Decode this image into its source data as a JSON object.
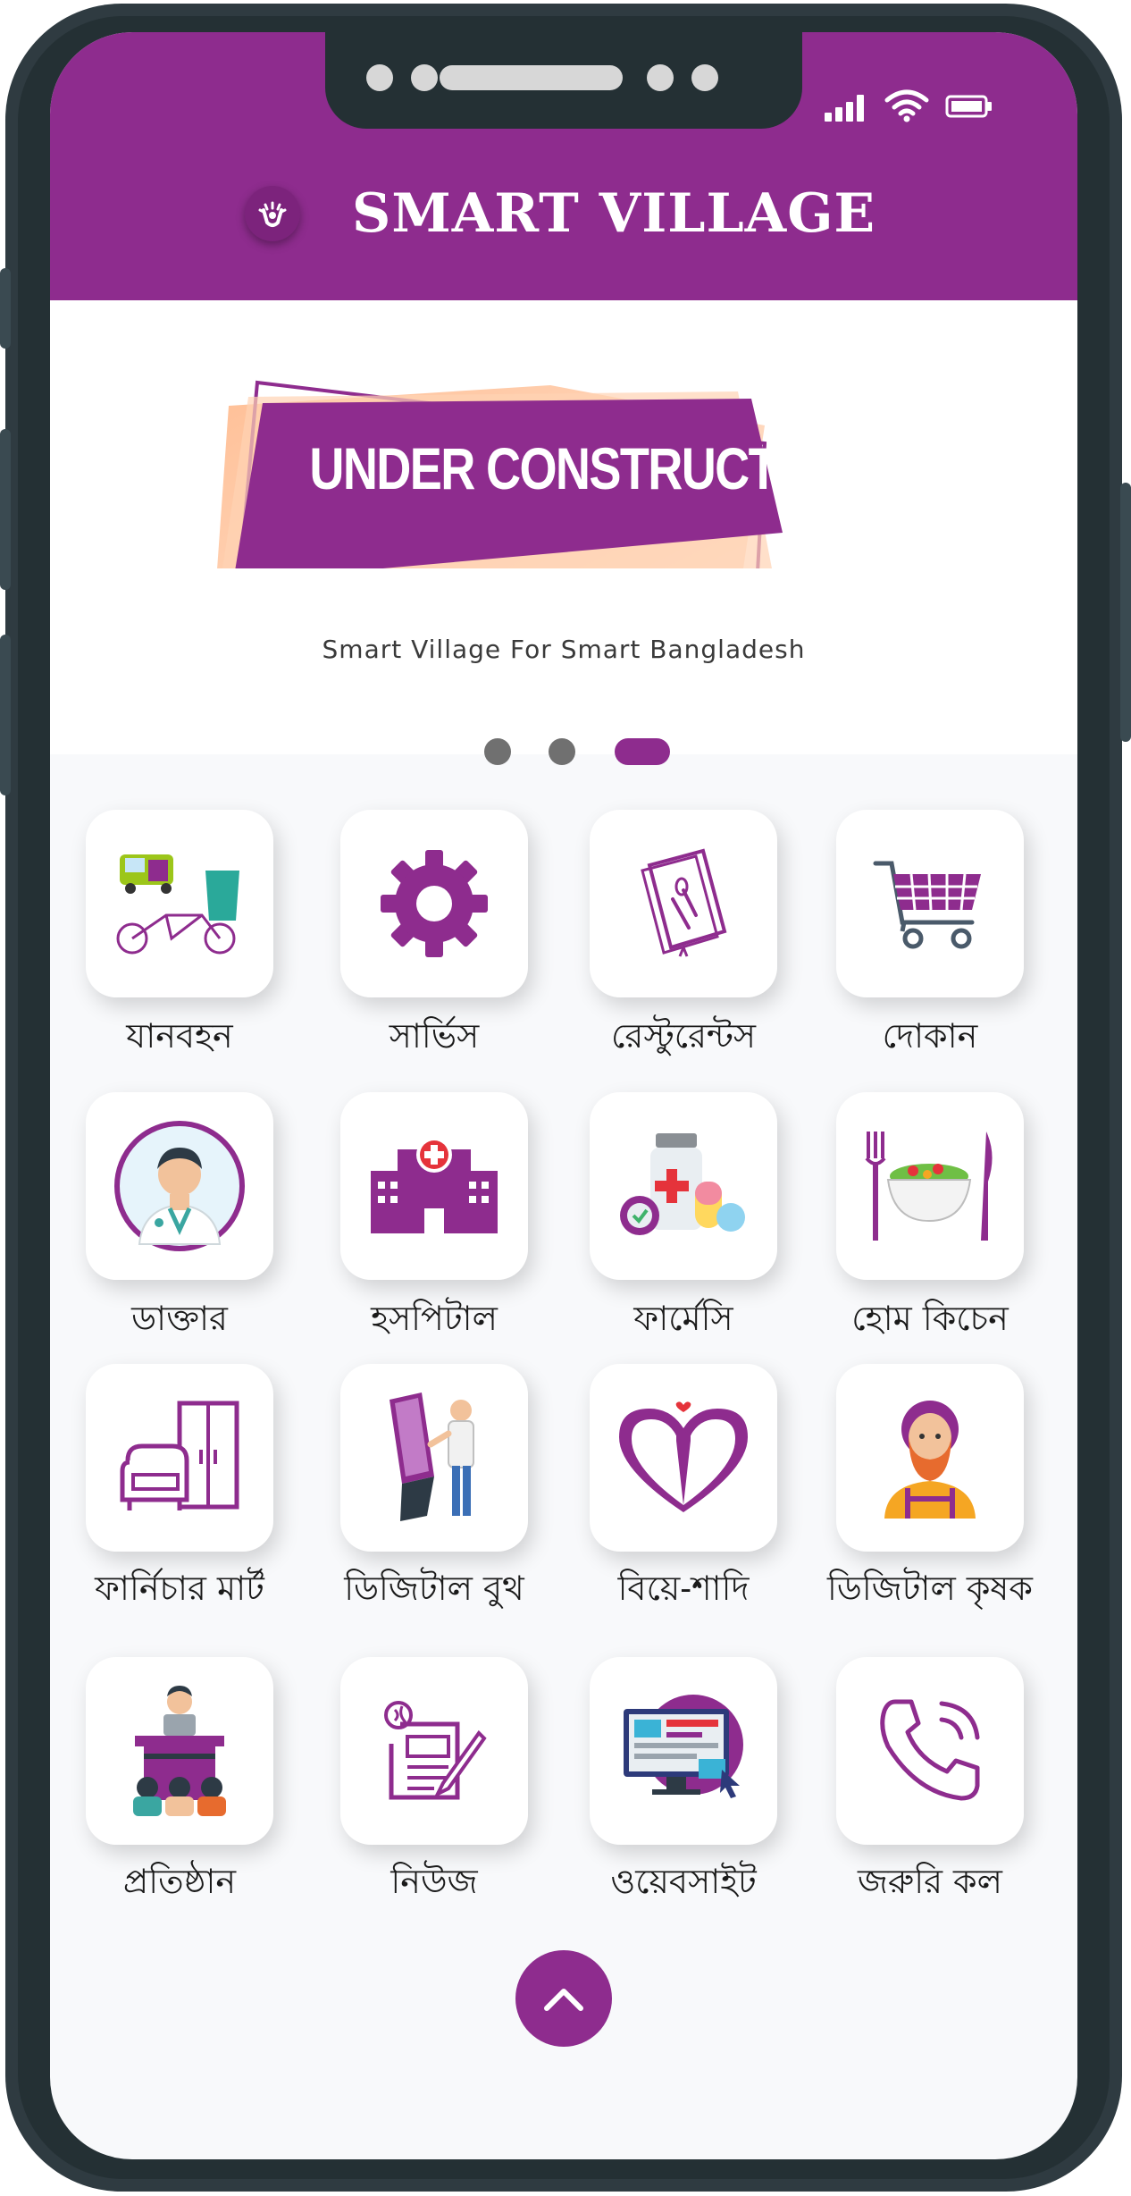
{
  "app": {
    "title": "SMART VILLAGE",
    "banner_text": "UNDER CONSTRUCTION",
    "tagline": "Smart Village For Smart Bangladesh",
    "accent_color": "#8e2c8e"
  },
  "status_bar": {
    "icons": [
      "signal-icon",
      "wifi-icon",
      "battery-icon"
    ]
  },
  "carousel": {
    "slides": 3,
    "active_index": 2
  },
  "services": [
    {
      "label": "যানবহন",
      "icon": "transport-icon"
    },
    {
      "label": "সার্ভিস",
      "icon": "gear-icon"
    },
    {
      "label": "রেস্টুরেন্টস",
      "icon": "restaurant-menu-icon"
    },
    {
      "label": "দোকান",
      "icon": "shopping-cart-icon"
    },
    {
      "label": "ডাক্তার",
      "icon": "doctor-icon"
    },
    {
      "label": "হসপিটাল",
      "icon": "hospital-icon"
    },
    {
      "label": "ফার্মেসি",
      "icon": "pharmacy-icon"
    },
    {
      "label": "হোম কিচেন",
      "icon": "home-kitchen-icon"
    },
    {
      "label": "ফার্নিচার মার্ট",
      "icon": "furniture-icon"
    },
    {
      "label": "ডিজিটাল বুথ",
      "icon": "digital-booth-icon"
    },
    {
      "label": "বিয়ে-শাদি",
      "icon": "wedding-heart-icon"
    },
    {
      "label": "ডিজিটাল কৃষক",
      "icon": "farmer-icon"
    },
    {
      "label": "প্রতিষ্ঠান",
      "icon": "institution-icon"
    },
    {
      "label": "নিউজ",
      "icon": "news-icon"
    },
    {
      "label": "ওয়েবসাইট",
      "icon": "website-icon"
    },
    {
      "label": "জরুরি কল",
      "icon": "phone-call-icon"
    }
  ],
  "scroll_top": {
    "icon": "chevron-up-icon"
  }
}
